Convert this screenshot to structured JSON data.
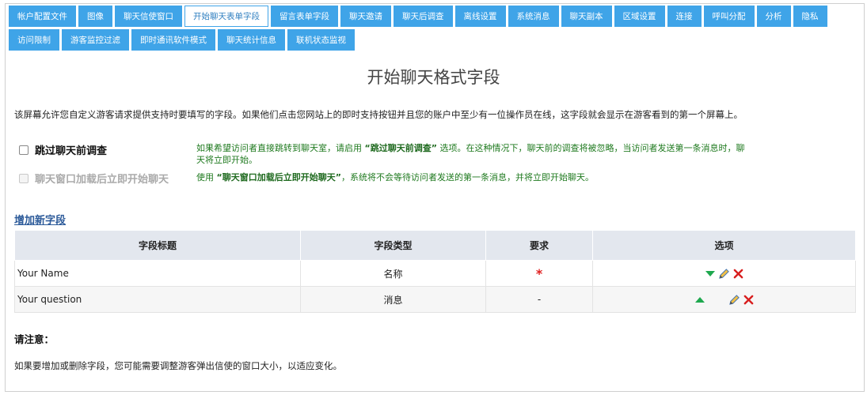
{
  "tabs": [
    {
      "label": "帐户配置文件"
    },
    {
      "label": "图像"
    },
    {
      "label": "聊天信使窗口"
    },
    {
      "label": "开始聊天表单字段",
      "active": true
    },
    {
      "label": "留言表单字段"
    },
    {
      "label": "聊天邀请"
    },
    {
      "label": "聊天后调查"
    },
    {
      "label": "离线设置"
    },
    {
      "label": "系统消息"
    },
    {
      "label": "聊天副本"
    },
    {
      "label": "区域设置"
    },
    {
      "label": "连接"
    },
    {
      "label": "呼叫分配"
    },
    {
      "label": "分析"
    },
    {
      "label": "隐私"
    },
    {
      "label": "访问限制"
    },
    {
      "label": "游客监控过滤"
    },
    {
      "label": "即时通讯软件模式"
    },
    {
      "label": "聊天统计信息"
    },
    {
      "label": "联机状态监视"
    }
  ],
  "page": {
    "title": "开始聊天格式字段",
    "intro": "该屏幕允许您自定义游客请求提供支持时要填写的字段。如果他们点击您网站上的即时支持按钮并且您的账户中至少有一位操作员在线，这字段就会显示在游客看到的第一个屏幕上。"
  },
  "options": {
    "skip_survey": {
      "label": "跳过聊天前调查",
      "help_pre": "如果希望访问者直接跳转到聊天室，请启用 ",
      "help_bold": "“跳过聊天前调查”",
      "help_post": " 选项。在这种情况下，聊天前的调查将被忽略，当访问者发送第一条消息时，聊",
      "help_line2": "天将立即开始。"
    },
    "start_on_load": {
      "label": "聊天窗口加载后立即开始聊天",
      "help_pre": "使用 ",
      "help_bold": "“聊天窗口加载后立即开始聊天”",
      "help_post": "，系统将不会等待访问者发送的第一条消息，并将立即开始聊天。"
    }
  },
  "add_field_link": "增加新字段",
  "table": {
    "headers": [
      "字段标题",
      "字段类型",
      "要求",
      "选项"
    ],
    "rows": [
      {
        "title": "Your Name",
        "type": "名称",
        "required": "*"
      },
      {
        "title": "Your question",
        "type": "消息",
        "required": "-"
      }
    ]
  },
  "note": {
    "title": "请注意：",
    "text": "如果要增加或删除字段，您可能需要调整游客弹出信使的窗口大小，以适应变化。"
  },
  "colors": {
    "tab_bg": "#3fa4e8",
    "help_text": "#1f7a1f",
    "link": "#2d5b9a",
    "required_star": "#e02020",
    "header_bg": "#e3e7ee"
  },
  "icons": {
    "move_down": "green-triangle-down-icon",
    "move_up": "green-triangle-up-icon",
    "edit": "pencil-icon",
    "delete": "red-x-icon"
  }
}
